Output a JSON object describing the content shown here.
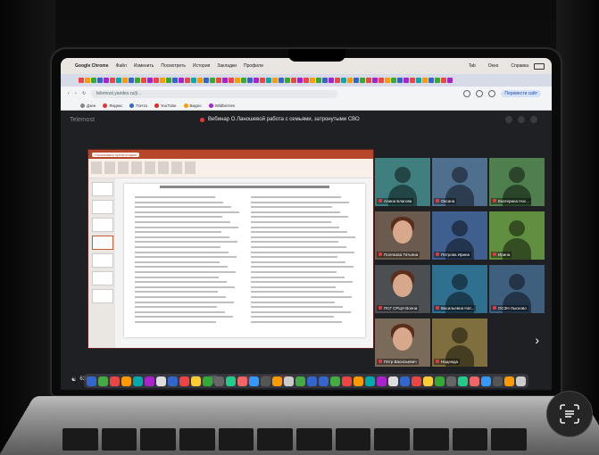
{
  "menubar": {
    "apple": "",
    "app": "Google Chrome",
    "items": [
      "Файл",
      "Изменить",
      "Посмотреть",
      "История",
      "Закладки",
      "Профили"
    ],
    "right": [
      "Tab",
      "Окно",
      "Справка"
    ]
  },
  "browser": {
    "url": "telemost.yandex.ru/j/...",
    "translate_label": "Перевести сайт",
    "bookmarks": [
      "Дзен",
      "Яндекс",
      "Почта",
      "YouTube",
      "Видео",
      "Wildberries"
    ]
  },
  "conference": {
    "app_name": "Telemost",
    "title": "Вебинар О.Ланошевой работа с семьями, затронутыми СВО",
    "share_label": "Показывать презентацию",
    "participant_count": "63/90",
    "participants": [
      {
        "name": "Алина Благова",
        "color": "#3f7f7f",
        "kind": "avatar"
      },
      {
        "name": "Оксана",
        "color": "#4f6f8f",
        "kind": "avatar"
      },
      {
        "name": "Екатерина Нос...",
        "color": "#4f7f4f",
        "kind": "avatar"
      },
      {
        "name": "Полякова Татьяна",
        "color": "#6b5a4e",
        "kind": "photo"
      },
      {
        "name": "Петрова Ирина",
        "color": "#3f5f8f",
        "kind": "avatar"
      },
      {
        "name": "Ирина",
        "color": "#5f8f3f",
        "kind": "avatar"
      },
      {
        "name": "ПСГ СРЦН Волна",
        "color": "#4b4f52",
        "kind": "photo"
      },
      {
        "name": "Васильевна Нат...",
        "color": "#2f6f8f",
        "kind": "avatar"
      },
      {
        "name": "ОСЗН Лысково",
        "color": "#3f5f7f",
        "kind": "avatar"
      },
      {
        "name": "Пётр Васильевич",
        "color": "#7a6a5a",
        "kind": "photo"
      },
      {
        "name": "Надежда",
        "color": "#7f6f3f",
        "kind": "avatar"
      },
      {
        "name": "",
        "color": "#1f2024",
        "kind": "next"
      }
    ]
  },
  "colors": {
    "accent": "#e03a3a",
    "ppt": "#b7472a",
    "telemost_bg": "#1f2024"
  }
}
